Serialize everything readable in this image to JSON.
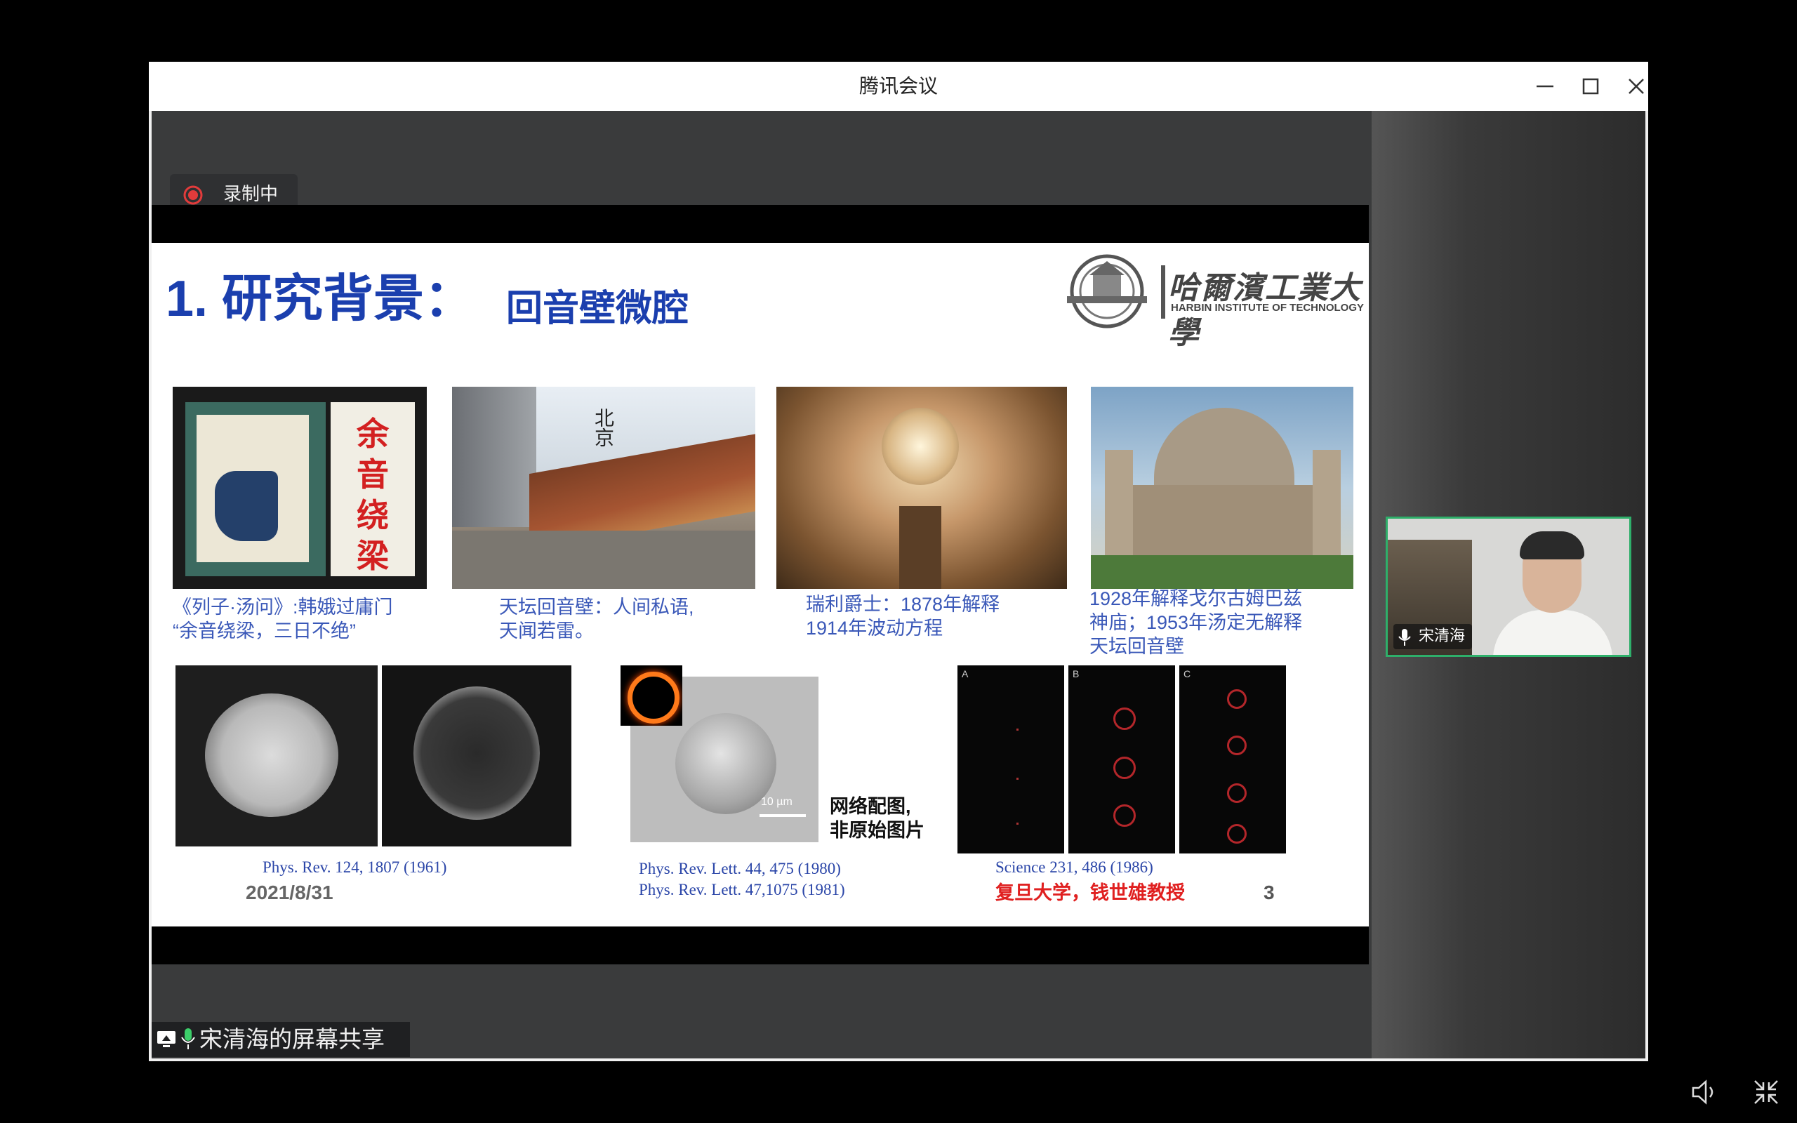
{
  "window": {
    "title": "腾讯会议"
  },
  "recording": {
    "label": "录制中"
  },
  "slide": {
    "title_main": "1. 研究背景：",
    "title_sub": "回音壁微腔",
    "logo_cn": "哈爾濱工業大學",
    "logo_en": "HARBIN INSTITUTE OF TECHNOLOGY",
    "poster_text": "余音绕梁",
    "beijing_text": "北京",
    "captions": [
      {
        "line1": "《列子·汤问》:韩娥过庸门",
        "line2": "“余音绕梁，三日不绝”"
      },
      {
        "line1": "天坛回音壁：人间私语,",
        "line2": "天闻若雷。"
      },
      {
        "line1": "瑞利爵士：1878年解释",
        "line2": "1914年波动方程"
      },
      {
        "line1": "1928年解释戈尔古姆巴兹",
        "line2": "神庙；1953年汤定无解释",
        "line3": "天坛回音壁"
      }
    ],
    "ref1": "Phys. Rev. 124, 1807 (1961)",
    "ref2a": "Phys. Rev. Lett. 44, 475 (1980)",
    "ref2b": "Phys. Rev. Lett. 47,1075 (1981)",
    "ref3": "Science 231, 486 (1986)",
    "net_note_1": "网络配图,",
    "net_note_2": "非原始图片",
    "scale_label": "10 µm",
    "panel_labels": [
      "A",
      "B",
      "C"
    ],
    "fudan": "复旦大学，钱世雄教授",
    "date": "2021/8/31",
    "page": "3"
  },
  "participant": {
    "name": "宋清海"
  },
  "share_label": "宋清海的屏幕共享",
  "colors": {
    "slide_title": "#1b3fae",
    "caption": "#3a58b8",
    "highlight_red": "#e02020",
    "video_border": "#2eaf6a"
  }
}
